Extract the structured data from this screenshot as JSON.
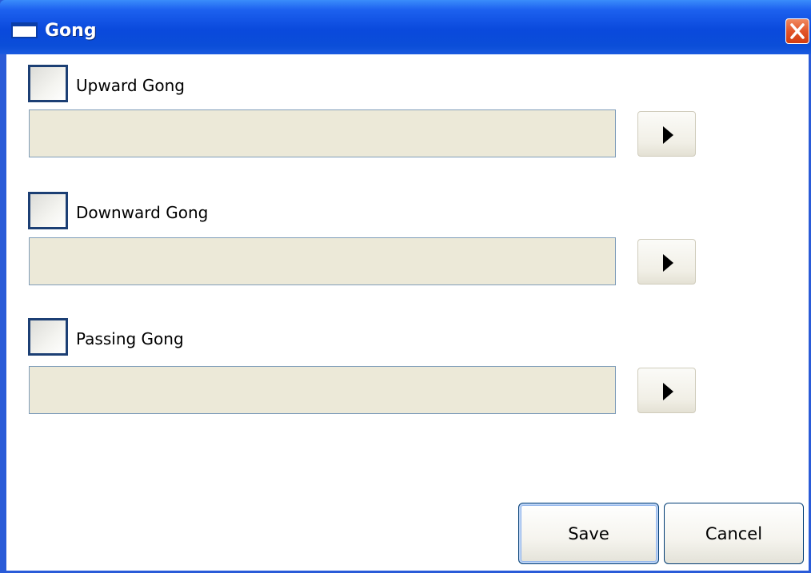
{
  "window": {
    "title": "Gong",
    "close_icon": "close-icon",
    "app_icon": "window-icon",
    "colors": {
      "titlebar": "#0a49dc",
      "close": "#e2552a",
      "field_background": "#ece9d8"
    }
  },
  "gongs": [
    {
      "label": "Upward Gong",
      "checked": false,
      "value": "",
      "play_icon": "play-icon"
    },
    {
      "label": "Downward Gong",
      "checked": false,
      "value": "",
      "play_icon": "play-icon"
    },
    {
      "label": "Passing Gong",
      "checked": false,
      "value": "",
      "play_icon": "play-icon"
    }
  ],
  "actions": {
    "save_label": "Save",
    "cancel_label": "Cancel"
  }
}
